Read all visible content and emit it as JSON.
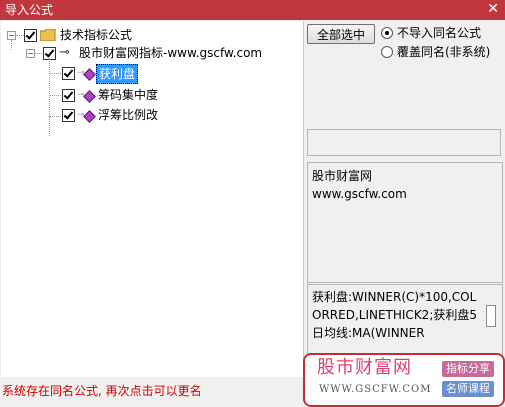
{
  "window": {
    "title": "导入公式",
    "close_icon": "close-icon"
  },
  "tree": {
    "root": {
      "label": "技术指标公式",
      "checked": true,
      "icon": "folder-icon"
    },
    "group": {
      "label": "股市财富网指标-www.gscfw.com",
      "checked": true,
      "icon": "key-icon"
    },
    "items": [
      {
        "label": "获利盘",
        "checked": true,
        "selected": true,
        "icon": "formula-diamond-icon"
      },
      {
        "label": "筹码集中度",
        "checked": true,
        "selected": false,
        "icon": "formula-diamond-icon"
      },
      {
        "label": "浮筹比例改",
        "checked": true,
        "selected": false,
        "icon": "formula-diamond-icon"
      }
    ]
  },
  "controls": {
    "select_all_label": "全部选中",
    "radio_options": [
      {
        "label": "不导入同名公式",
        "selected": true
      },
      {
        "label": "覆盖同名(非系统)",
        "selected": false
      }
    ]
  },
  "description": {
    "line1": "股市财富网",
    "line2": "www.gscfw.com"
  },
  "code": {
    "text": "获利盘:WINNER(C)*100,COLORRED,LINETHICK2;获利盘5日均线:MA(WINNER"
  },
  "status": {
    "text": "系统存在同名公式, 再次点击可以更名"
  },
  "brand": {
    "name": "股市财富网",
    "url": "WWW.GSCFW.COM",
    "tag1": "指标分享",
    "tag2": "名师课程"
  },
  "colors": {
    "titlebar": "#c0383e",
    "selection": "#3399ff",
    "status": "#d00000",
    "brand_border": "#c62c37"
  }
}
